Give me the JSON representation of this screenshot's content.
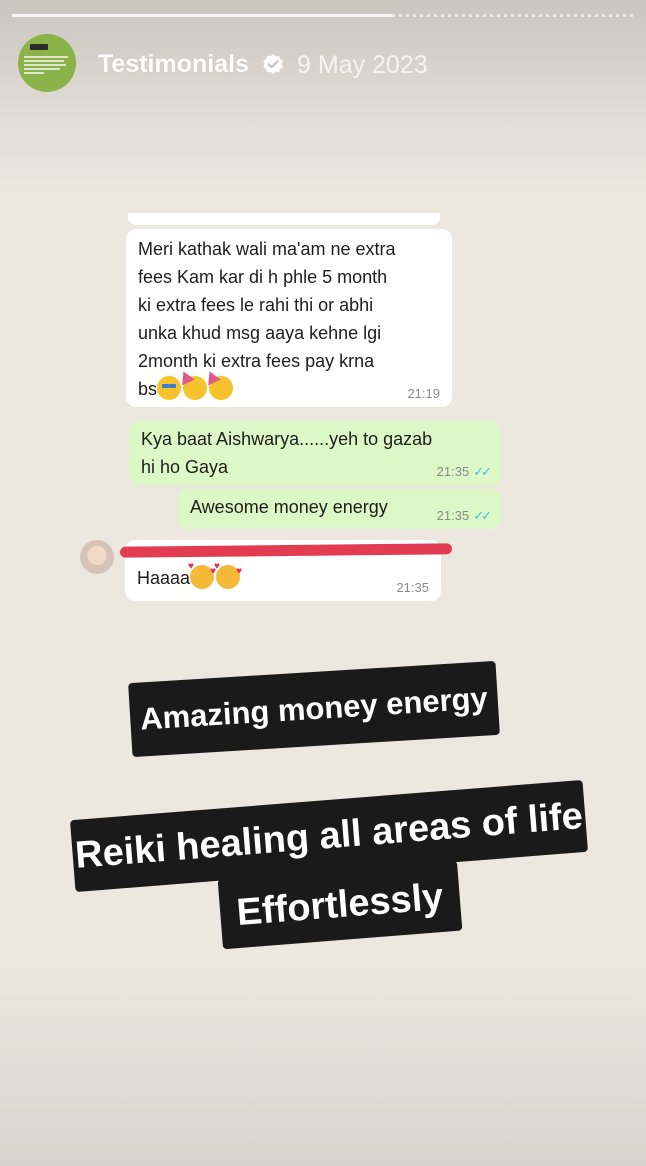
{
  "story": {
    "progress_done_fraction": 0.61,
    "account_name": "Testimonials",
    "verified_icon": "verified-badge-icon",
    "date": "9 May 2023"
  },
  "chat": {
    "messages": [
      {
        "direction": "incoming",
        "lines": [
          "Meri kathak wali ma'am ne extra",
          "fees Kam kar di h phle 5 month",
          "ki extra fees le rahi thi or abhi",
          "unka khud msg aaya kehne lgi",
          "2month ki extra fees pay krna"
        ],
        "last_line_text": "bs",
        "emojis": [
          "star-struck-emoji",
          "partying-face-emoji",
          "partying-face-emoji"
        ],
        "time": "21:19"
      },
      {
        "direction": "outgoing",
        "lines": [
          "Kya baat Aishwarya......yeh to gazab",
          "hi ho Gaya"
        ],
        "time": "21:35",
        "ticks": "read"
      },
      {
        "direction": "outgoing",
        "lines": [
          "Awesome money energy"
        ],
        "time": "21:35",
        "ticks": "read"
      },
      {
        "direction": "incoming",
        "text": "Haaaa",
        "emojis": [
          "smiling-face-with-hearts-emoji",
          "smiling-face-with-hearts-emoji"
        ],
        "time": "21:35"
      }
    ]
  },
  "stickers": {
    "line1": "Amazing money energy",
    "line2": "Reiki healing all areas of life",
    "line3": "Effortlessly"
  },
  "colors": {
    "outgoing_bubble": "#dcf8c6",
    "incoming_bubble": "#ffffff",
    "read_ticks": "#4fb6ec",
    "redaction": "#e23b52",
    "sticker_bg": "#1a1a1a",
    "avatar_bg": "#8ab34a"
  }
}
